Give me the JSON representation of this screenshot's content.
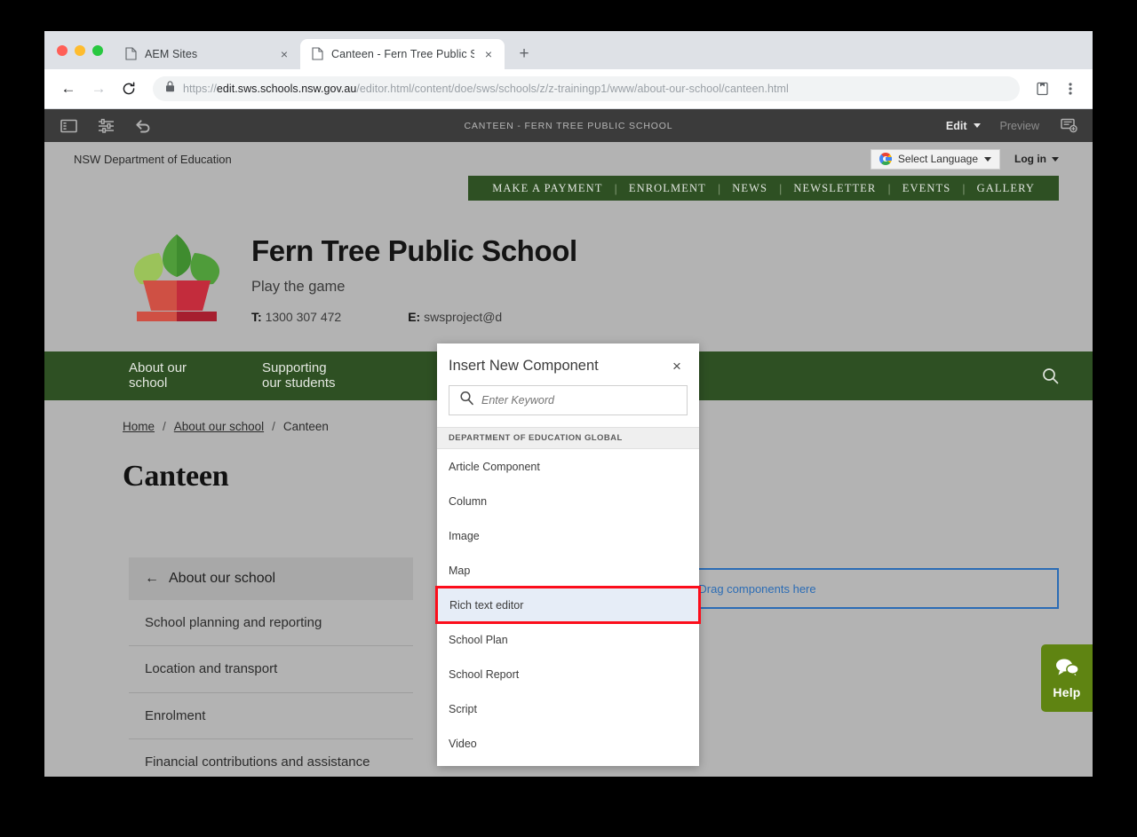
{
  "browser": {
    "tabs": [
      {
        "title": "AEM Sites",
        "active": false,
        "close_label": "×"
      },
      {
        "title": "Canteen - Fern Tree Public Sch",
        "active": true,
        "close_label": "×"
      }
    ],
    "new_tab_label": "+",
    "back_label": "←",
    "forward_label": "→",
    "reload_label": "⟳",
    "url_scheme": "https://",
    "url_host": "edit.sws.schools.nsw.gov.au",
    "url_path": "/editor.html/content/doe/sws/schools/z/z-trainingp1/www/about-our-school/canteen.html"
  },
  "aem": {
    "title": "CANTEEN - FERN TREE PUBLIC SCHOOL",
    "edit_label": "Edit",
    "preview_label": "Preview",
    "icons": {
      "sidebar": "sidebar-panel-icon",
      "sliders": "page-properties-icon",
      "undo": "undo-icon",
      "annotate": "annotate-icon"
    }
  },
  "site_topbar": {
    "department": "NSW Department of Education",
    "language_label": "Select Language",
    "login_label": "Log in"
  },
  "quicklinks": [
    "MAKE A PAYMENT",
    "ENROLMENT",
    "NEWS",
    "NEWSLETTER",
    "EVENTS",
    "GALLERY"
  ],
  "school": {
    "name": "Fern Tree Public School",
    "tagline": "Play the game",
    "phone_label": "T:",
    "phone": "1300 307 472",
    "email_label": "E:",
    "email": "swsproject@d"
  },
  "mainnav": [
    "About our school",
    "Supporting our students"
  ],
  "breadcrumbs": {
    "home": "Home",
    "parent": "About our school",
    "current": "Canteen",
    "separator": "/"
  },
  "page": {
    "title": "Canteen",
    "dropzone_text": "Drag components here"
  },
  "leftnav": {
    "header": "About our school",
    "back_arrow": "←",
    "items": [
      "School planning and reporting",
      "Location and transport",
      "Enrolment",
      "Financial contributions and assistance"
    ]
  },
  "help": {
    "label": "Help"
  },
  "modal": {
    "title": "Insert New Component",
    "close_label": "×",
    "search_placeholder": "Enter Keyword",
    "search_value": "",
    "group_label": "DEPARTMENT OF EDUCATION GLOBAL",
    "items": [
      {
        "label": "Article Component",
        "selected": false
      },
      {
        "label": "Column",
        "selected": false
      },
      {
        "label": "Image",
        "selected": false
      },
      {
        "label": "Map",
        "selected": false
      },
      {
        "label": "Rich text editor",
        "selected": true
      },
      {
        "label": "School Plan",
        "selected": false
      },
      {
        "label": "School Report",
        "selected": false
      },
      {
        "label": "Script",
        "selected": false
      },
      {
        "label": "Video",
        "selected": false
      }
    ]
  },
  "colors": {
    "school_green": "#2e5023",
    "help_green": "#5f8412",
    "highlight_red": "#fc0d1b",
    "selection_blue": "#e6edf7",
    "dropzone_blue": "#2b6cb5"
  }
}
